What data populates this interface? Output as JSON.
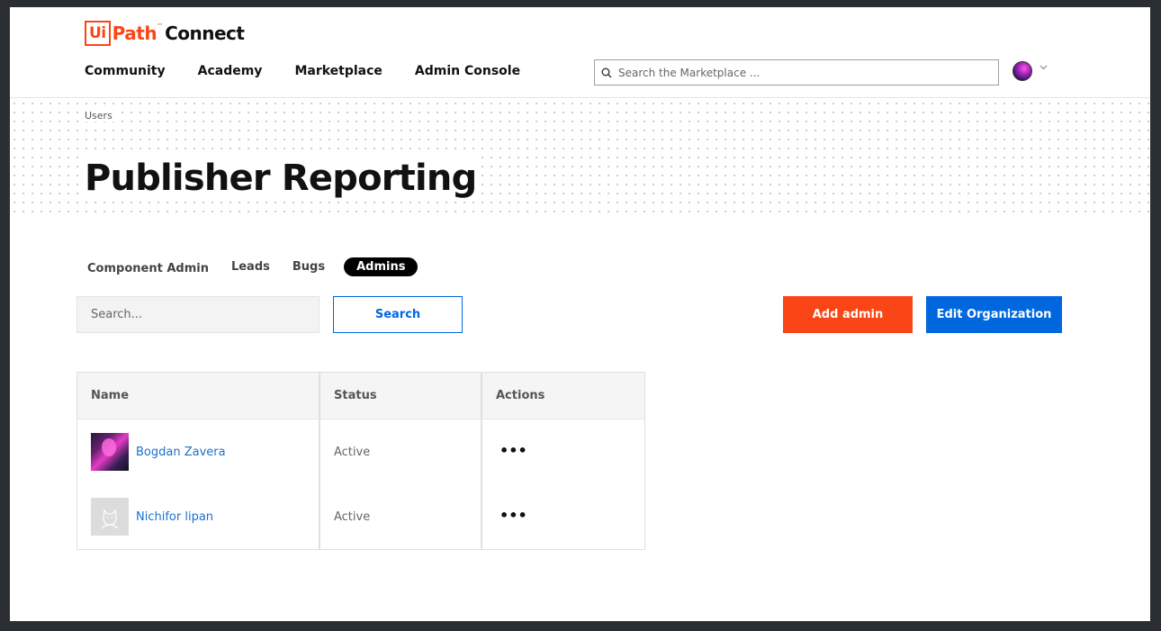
{
  "brand": {
    "logo_ui": "Ui",
    "logo_path": "Path",
    "logo_tm": "™",
    "logo_connect": "Connect",
    "accent_color": "#fa4616",
    "link_color": "#1a6fd1",
    "primary_color": "#0067df"
  },
  "nav": {
    "items": [
      "Community",
      "Academy",
      "Marketplace",
      "Admin Console"
    ]
  },
  "header_search": {
    "placeholder": "Search the Marketplace ..."
  },
  "breadcrumb": "Users",
  "page_title": "Publisher Reporting",
  "tabs": [
    {
      "label": "Component Admin",
      "active": false
    },
    {
      "label": "Leads",
      "active": false
    },
    {
      "label": "Bugs",
      "active": false
    },
    {
      "label": "Admins",
      "active": true
    }
  ],
  "filter": {
    "placeholder": "Search...",
    "search_button": "Search",
    "add_admin_button": "Add admin",
    "edit_org_button": "Edit Organization"
  },
  "table": {
    "headers": [
      "Name",
      "Status",
      "Actions"
    ],
    "rows": [
      {
        "name": "Bogdan Zavera",
        "status": "Active",
        "actions": "•••"
      },
      {
        "name": "Nichifor lipan",
        "status": "Active",
        "actions": "•••"
      }
    ]
  }
}
